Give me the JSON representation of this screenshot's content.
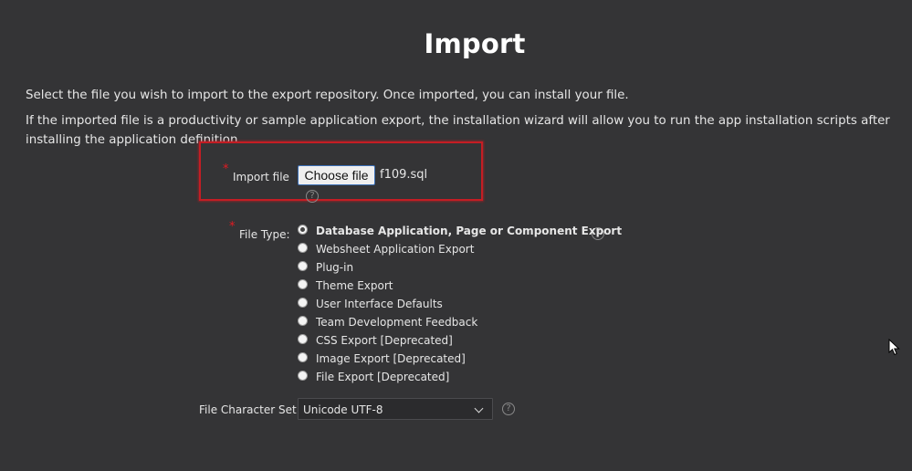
{
  "page": {
    "title": "Import"
  },
  "instructions": {
    "line1": "Select the file you wish to import to the export repository. Once imported, you can install your file.",
    "line2": "If the imported file is a productivity or sample application export, the installation wizard will allow you to run the app installation scripts after installing the application definition."
  },
  "import_file": {
    "required_marker": "*",
    "label": "Import file",
    "button_label": "Choose file",
    "file_name": "f109.sql",
    "help_glyph": "?"
  },
  "file_type": {
    "required_marker": "*",
    "label": "File Type:",
    "help_glyph": "?",
    "selected_index": 0,
    "options": [
      "Database Application, Page or Component Export",
      "Websheet Application Export",
      "Plug-in",
      "Theme Export",
      "User Interface Defaults",
      "Team Development Feedback",
      "CSS Export [Deprecated]",
      "Image Export [Deprecated]",
      "File Export [Deprecated]"
    ]
  },
  "character_set": {
    "label": "File Character Set",
    "value": "Unicode UTF-8",
    "help_glyph": "?"
  },
  "colors": {
    "background": "#343436",
    "highlight_border": "#c41d24",
    "required": "#e21b22"
  },
  "icons": {
    "help": "help-circle-icon",
    "dropdown": "chevron-down-icon",
    "cursor": "mouse-pointer-icon"
  }
}
